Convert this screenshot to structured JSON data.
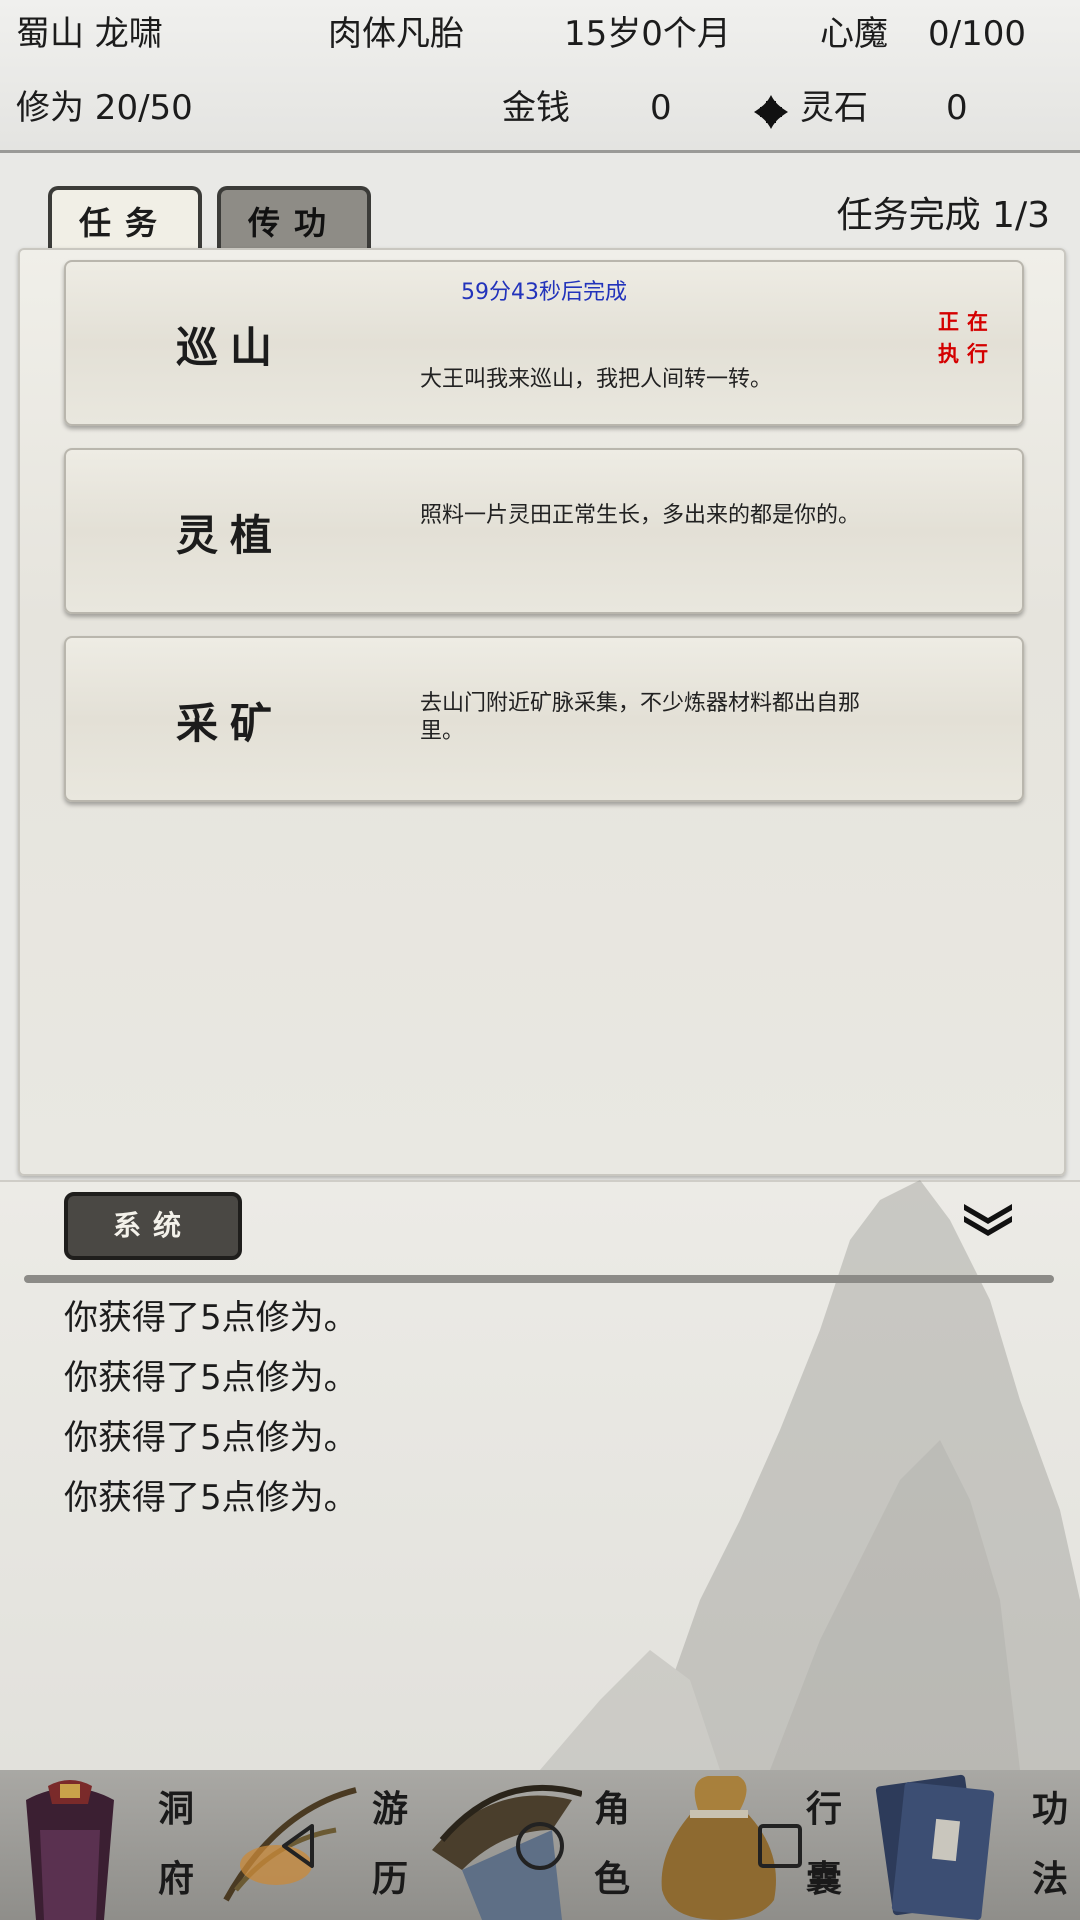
{
  "status": {
    "sect_name": "蜀山 龙啸",
    "realm": "肉体凡胎",
    "age": "15岁0个月",
    "heart_demon_label": "心魔",
    "heart_demon_value": "0/100",
    "cultivation": "修为 20/50",
    "money_label": "金钱",
    "money_value": "0",
    "spirit_stone_label": "灵石",
    "spirit_stone_value": "0"
  },
  "tabs": [
    {
      "label": "任务",
      "active": true
    },
    {
      "label": "传功",
      "active": false
    }
  ],
  "task_progress": "任务完成  1/3",
  "tasks": [
    {
      "name": "巡山",
      "timer": "59分43秒后完成",
      "desc": "大王叫我来巡山，我把人间转一转。",
      "status_line1": "正在",
      "status_line2": "执行"
    },
    {
      "name": "灵植",
      "desc": "照料一片灵田正常生长，多出来的都是你的。"
    },
    {
      "name": "采矿",
      "desc": "去山门附近矿脉采集，不少炼器材料都出自那里。"
    }
  ],
  "log": {
    "tab_label": "系统",
    "lines": [
      "你获得了5点修为。",
      "你获得了5点修为。",
      "你获得了5点修为。",
      "你获得了5点修为。"
    ]
  },
  "nav": [
    {
      "label1": "洞",
      "label2": "府",
      "icon": "palace-icon"
    },
    {
      "label1": "游",
      "label2": "历",
      "icon": "travel-icon"
    },
    {
      "label1": "角",
      "label2": "色",
      "icon": "character-icon"
    },
    {
      "label1": "行",
      "label2": "囊",
      "icon": "bag-icon"
    },
    {
      "label1": "功",
      "label2": "法",
      "icon": "book-icon"
    }
  ],
  "system_buttons": [
    "back-icon",
    "home-icon",
    "recents-icon"
  ],
  "colors": {
    "timer": "#2233bb",
    "status": "#d40000",
    "tab_active": "#f1efe6",
    "tab_inactive": "#8e8c86"
  }
}
